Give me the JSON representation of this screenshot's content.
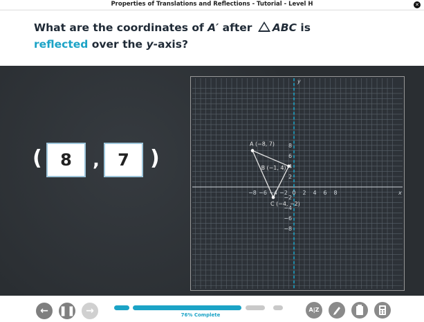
{
  "window": {
    "title": "Properties of Translations and Reflections - Tutorial - Level H",
    "close_glyph": "✕"
  },
  "question": {
    "part1": "What are the coordinates of ",
    "a_prime": "A′",
    "part2": " after ",
    "abc": "ABC",
    "part3": " is",
    "reflected": "reflected",
    "part4": " over the ",
    "yaxis": "y",
    "part5": "-axis?"
  },
  "answer": {
    "open_paren": "(",
    "x": "8",
    "comma": ",",
    "y": "7",
    "close_paren": ")"
  },
  "graph": {
    "x_label": "x",
    "y_label": "y",
    "x_ticks": [
      "−8",
      "−6",
      "−4",
      "−2",
      "0",
      "2",
      "4",
      "6",
      "8"
    ],
    "y_ticks": [
      "8",
      "6",
      "4",
      "2",
      "−2",
      "−4",
      "−6",
      "−8"
    ],
    "points": [
      {
        "name": "A",
        "x": -8,
        "y": 7,
        "label": "A (−8, 7)"
      },
      {
        "name": "B",
        "x": -1,
        "y": 4,
        "label": "B (−1, 4)"
      },
      {
        "name": "C",
        "x": -4,
        "y": -2,
        "label": "C (−4, −2)"
      }
    ],
    "colors": {
      "grid": "#5a636b",
      "axis": "#cfd6db",
      "triangle": "#e6e6e6",
      "y_axis_highlight": "#1ba3c6"
    }
  },
  "footer": {
    "progress_label": "76% Complete",
    "progress": 0.76,
    "back_icon": "arrow-left-icon",
    "pause_icon": "pause-icon",
    "forward_icon": "arrow-right-icon",
    "tools": [
      "glossary-icon",
      "pencil-icon",
      "clipboard-icon",
      "calculator-icon"
    ],
    "glossary_glyph": "A|Z"
  }
}
